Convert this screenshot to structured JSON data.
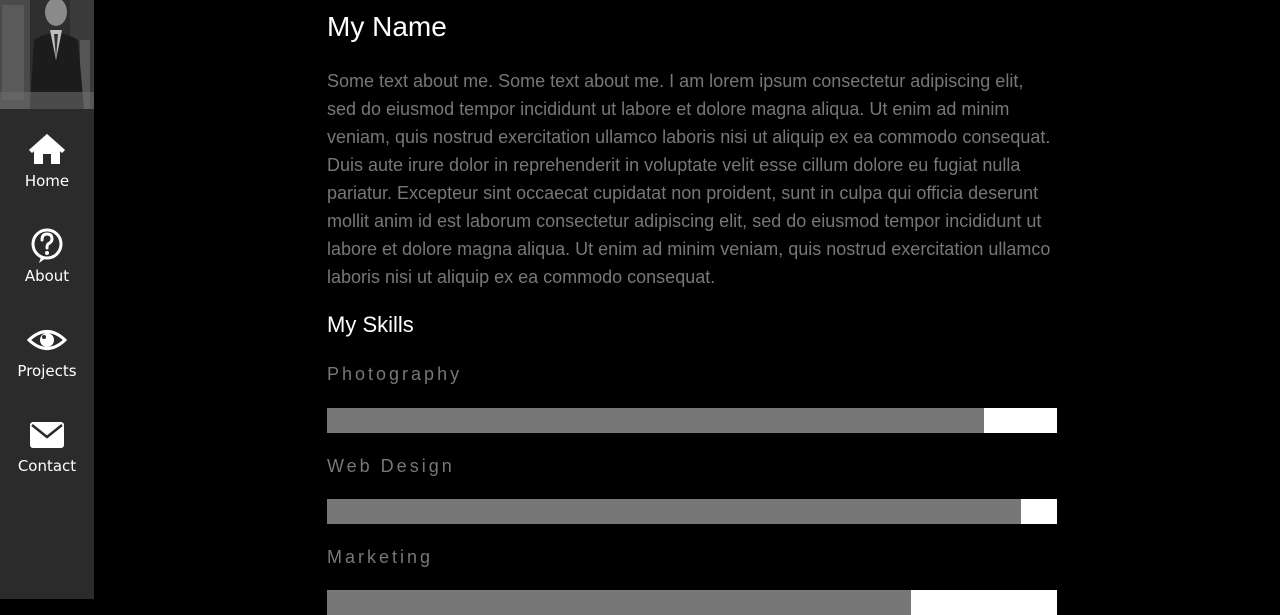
{
  "nav": {
    "items": [
      {
        "label": "Home",
        "icon": "home-icon"
      },
      {
        "label": "About",
        "icon": "question-circle-icon"
      },
      {
        "label": "Projects",
        "icon": "eye-icon"
      },
      {
        "label": "Contact",
        "icon": "envelope-icon"
      }
    ]
  },
  "profile": {
    "name": "My Name",
    "about": "Some text about me. Some text about me. I am lorem ipsum consectetur adipiscing elit, sed do eiusmod tempor incididunt ut labore et dolore magna aliqua. Ut enim ad minim veniam, quis nostrud exercitation ullamco laboris nisi ut aliquip ex ea commodo consequat. Duis aute irure dolor in reprehenderit in voluptate velit esse cillum dolore eu fugiat nulla pariatur. Excepteur sint occaecat cupidatat non proident, sunt in culpa qui officia deserunt mollit anim id est laborum consectetur adipiscing elit, sed do eiusmod tempor incididunt ut labore et dolore magna aliqua. Ut enim ad minim veniam, quis nostrud exercitation ullamco laboris nisi ut aliquip ex ea commodo consequat."
  },
  "skills": {
    "title": "My Skills",
    "items": [
      {
        "label": "Photography",
        "percent": 90
      },
      {
        "label": "Web Design",
        "percent": 95
      },
      {
        "label": "Marketing",
        "percent": 80
      }
    ]
  },
  "colors": {
    "background": "#000000",
    "sidebar": "#2b2b2b",
    "muted_text": "#777777",
    "bar_fill": "#777777",
    "bar_track": "#ffffff"
  }
}
